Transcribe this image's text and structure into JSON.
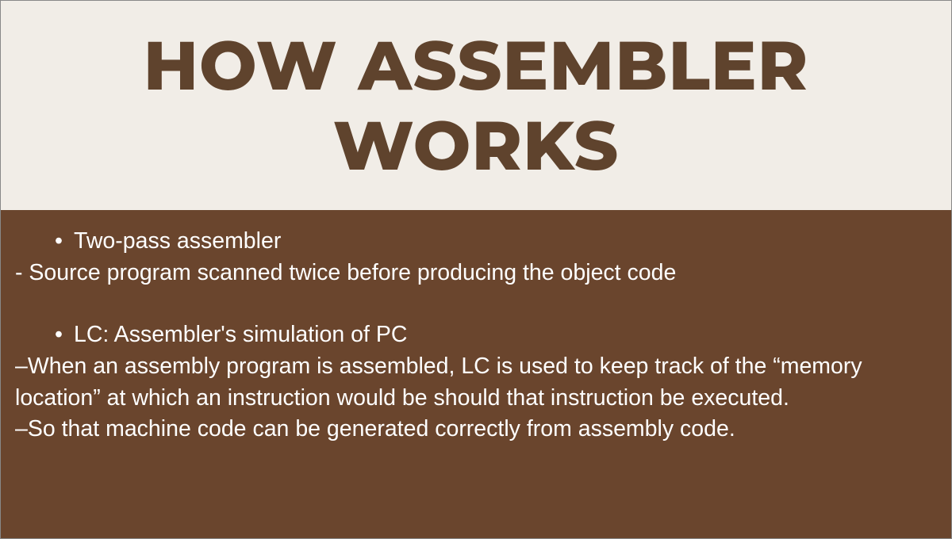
{
  "title": "HOW ASSEMBLER WORKS",
  "body": {
    "bullet1": "Two-pass assembler",
    "line1": "- Source program scanned twice before producing the object code",
    "bullet2": "LC: Assembler's simulation of PC",
    "line2": "–When an assembly program is assembled, LC is used to keep track of the “memory location” at which an instruction would be should that instruction be executed.",
    "line3": "–So that machine code can be generated correctly from assembly code."
  }
}
